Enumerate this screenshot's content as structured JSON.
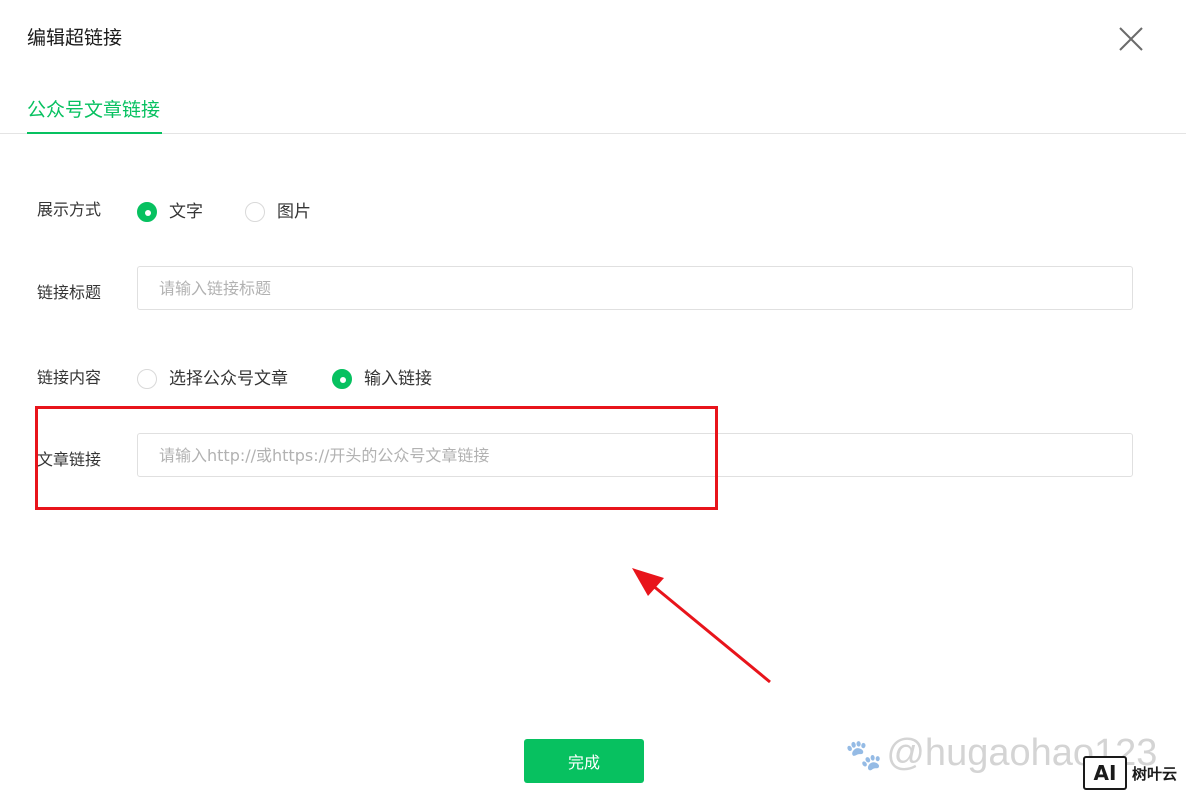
{
  "dialog": {
    "title": "编辑超链接",
    "close_icon": "close-x-icon"
  },
  "tabs": [
    {
      "label": "公众号文章链接",
      "active": true
    }
  ],
  "display_mode": {
    "label": "展示方式",
    "options": [
      {
        "label": "文字",
        "checked": true
      },
      {
        "label": "图片",
        "checked": false
      }
    ]
  },
  "link_title": {
    "label": "链接标题",
    "value": "",
    "placeholder": "请输入链接标题"
  },
  "link_content": {
    "label": "链接内容",
    "options": [
      {
        "label": "选择公众号文章",
        "checked": false
      },
      {
        "label": "输入链接",
        "checked": true
      }
    ]
  },
  "article_link": {
    "label": "文章链接",
    "value": "",
    "placeholder": "请输入http://或https://开头的公众号文章链接"
  },
  "footer": {
    "done_label": "完成"
  },
  "watermark": {
    "text": "@hugaohao123",
    "brand": "树叶云",
    "brand_logo": "AI"
  },
  "colors": {
    "accent": "#07c160",
    "annotation": "#e8141b"
  }
}
